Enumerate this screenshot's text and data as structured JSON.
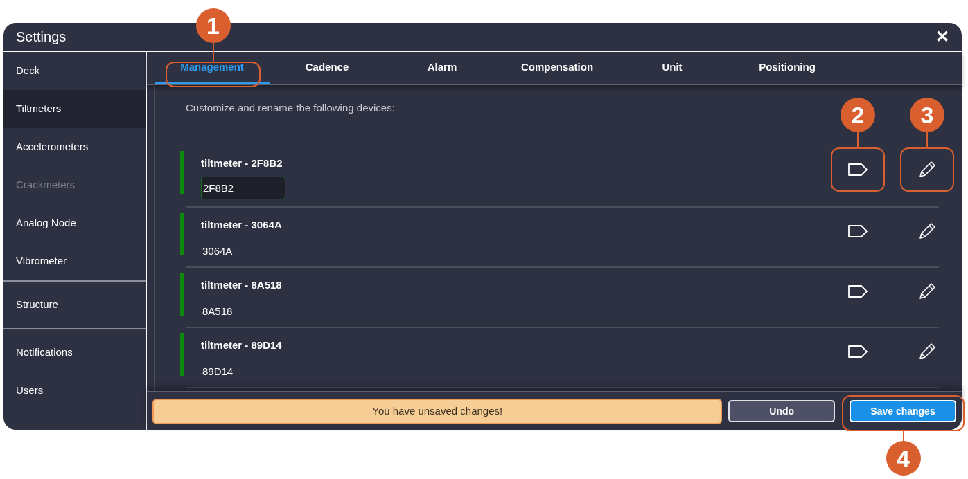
{
  "window": {
    "title": "Settings",
    "close": "✕"
  },
  "sidebar": {
    "groups": [
      [
        {
          "label": "Deck",
          "selected": false,
          "disabled": false
        },
        {
          "label": "Tiltmeters",
          "selected": true,
          "disabled": false
        },
        {
          "label": "Accelerometers",
          "selected": false,
          "disabled": false
        },
        {
          "label": "Crackmeters",
          "selected": false,
          "disabled": true
        },
        {
          "label": "Analog Node",
          "selected": false,
          "disabled": false
        },
        {
          "label": "Vibrometer",
          "selected": false,
          "disabled": false
        }
      ],
      [
        {
          "label": "Structure",
          "selected": false,
          "disabled": false
        }
      ],
      [
        {
          "label": "Notifications",
          "selected": false,
          "disabled": false
        },
        {
          "label": "Users",
          "selected": false,
          "disabled": false
        }
      ]
    ]
  },
  "tabs": [
    {
      "label": "Management",
      "selected": true,
      "callout": "1"
    },
    {
      "label": "Cadence",
      "selected": false
    },
    {
      "label": "Alarm",
      "selected": false
    },
    {
      "label": "Compensation",
      "selected": false
    },
    {
      "label": "Unit",
      "selected": false
    },
    {
      "label": "Positioning",
      "selected": false
    }
  ],
  "intro": "Customize and rename the following devices:",
  "devices": [
    {
      "name": "tiltmeter - 2F8B2",
      "value": "2F8B2",
      "editing": true,
      "color": "#0b8a0b",
      "tag_callout": "2",
      "edit_callout": "3"
    },
    {
      "name": "tiltmeter - 3064A",
      "value": "3064A",
      "editing": false,
      "color": "#0b8a0b"
    },
    {
      "name": "tiltmeter - 8A518",
      "value": "8A518",
      "editing": false,
      "color": "#0b8a0b"
    },
    {
      "name": "tiltmeter - 89D14",
      "value": "89D14",
      "editing": false,
      "color": "#0b8a0b"
    }
  ],
  "footer": {
    "message": "You have unsaved changes!",
    "undo": "Undo",
    "save": "Save changes",
    "save_callout": "4"
  }
}
